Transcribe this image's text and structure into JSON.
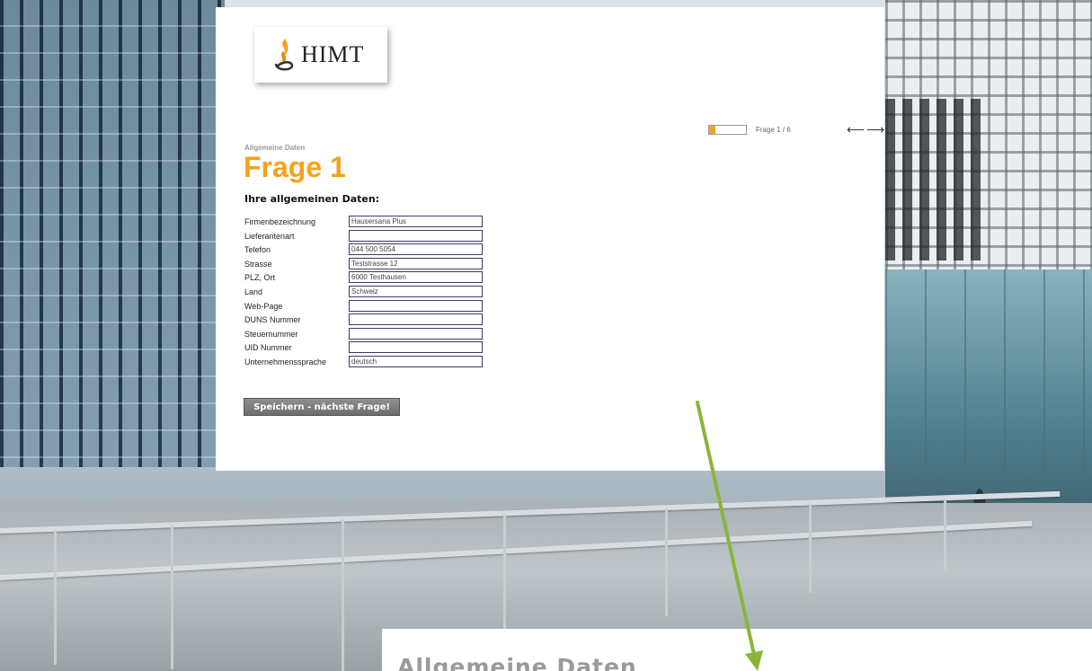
{
  "header": {
    "logo_text": "HIMT",
    "progress": {
      "percent": 17,
      "label": "17%"
    },
    "frage_count": "Frage 1 / 6",
    "nav": {
      "back_arrow": "⟵",
      "forward_arrow": "⟶"
    }
  },
  "main": {
    "section_label": "Allgemeine Daten",
    "title": "Frage 1",
    "subheading": "Ihre allgemeinen Daten:",
    "fields": [
      {
        "label": "Firmenbezeichnung",
        "value": "Hausersana Plus"
      },
      {
        "label": "Lieferantenart",
        "value": ""
      },
      {
        "label": "Telefon",
        "value": "044 500 5054"
      },
      {
        "label": "Strasse",
        "value": "Teststrasse 12"
      },
      {
        "label": "PLZ, Ort",
        "value": "6000 Testhausen"
      },
      {
        "label": "Land",
        "value": "Schweiz"
      },
      {
        "label": "Web-Page",
        "value": ""
      },
      {
        "label": "DUNS Nummer",
        "value": ""
      },
      {
        "label": "Steuernummer",
        "value": ""
      },
      {
        "label": "UID Nummer",
        "value": ""
      },
      {
        "label": "Unternehmenssprache",
        "value": "deutsch"
      }
    ],
    "save_button": "Speichern - nächste Frage!"
  },
  "zoom_callout": {
    "text": "Allgemeine Daten"
  },
  "colors": {
    "accent": "#f5a21a",
    "annotation_arrow": "#8ab53a"
  }
}
